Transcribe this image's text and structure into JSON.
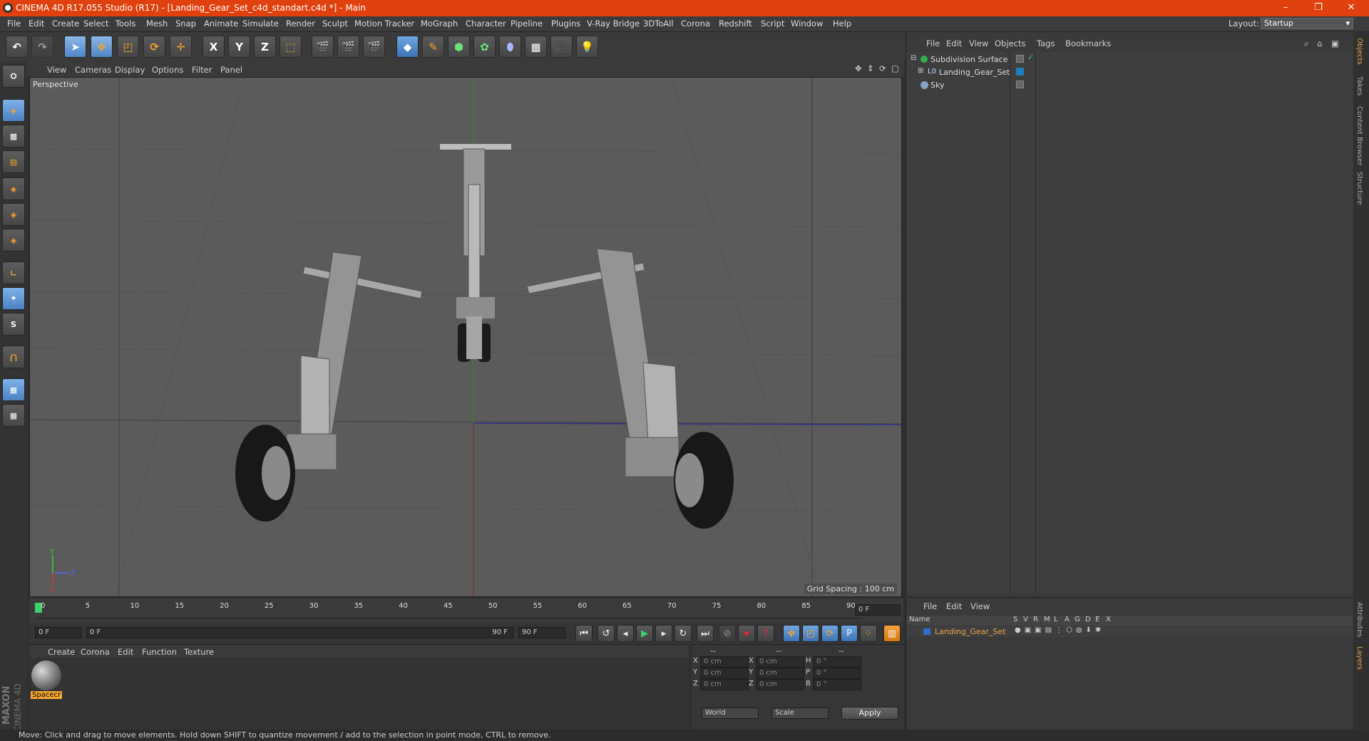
{
  "window": {
    "title": "CINEMA 4D R17.055 Studio (R17) - [Landing_Gear_Set_c4d_standart.c4d *] - Main",
    "controls": [
      "–",
      "❐",
      "✕"
    ]
  },
  "menu": [
    "File",
    "Edit",
    "Create",
    "Select",
    "Tools",
    "Mesh",
    "Snap",
    "Animate",
    "Simulate",
    "Render",
    "Sculpt",
    "Motion Tracker",
    "MoGraph",
    "Character",
    "Pipeline",
    "Plugins",
    "V-Ray Bridge",
    "3DToAll",
    "Corona",
    "Redshift",
    "Script",
    "Window",
    "Help"
  ],
  "layout": {
    "label": "Layout:",
    "value": "Startup"
  },
  "toolbar": {
    "axis_x": "X",
    "axis_y": "Y",
    "axis_z": "Z"
  },
  "left_tools": {
    "snap_s": "S"
  },
  "viewport": {
    "menu": [
      "View",
      "Cameras",
      "Display",
      "Options",
      "Filter",
      "Panel"
    ],
    "label": "Perspective",
    "grid_spacing": "Grid Spacing : 100 cm"
  },
  "timeline": {
    "ticks": [
      "0",
      "5",
      "10",
      "15",
      "20",
      "25",
      "30",
      "35",
      "40",
      "45",
      "50",
      "55",
      "60",
      "65",
      "70",
      "75",
      "80",
      "85",
      "90"
    ],
    "current_frame_field": "0 F",
    "start_field": "0 F",
    "range_start": "0 F",
    "range_end": "90 F",
    "end_field": "90 F"
  },
  "materials": {
    "menu": [
      "Create",
      "Corona",
      "Edit",
      "Function",
      "Texture"
    ],
    "items": [
      {
        "name": "Spacecr"
      }
    ]
  },
  "coordinates": {
    "headers": [
      "--",
      "--",
      "--"
    ],
    "rows": [
      {
        "l1": "X",
        "v1": "0 cm",
        "l2": "X",
        "v2": "0 cm",
        "l3": "H",
        "v3": "0 °"
      },
      {
        "l1": "Y",
        "v1": "0 cm",
        "l2": "Y",
        "v2": "0 cm",
        "l3": "P",
        "v3": "0 °"
      },
      {
        "l1": "Z",
        "v1": "0 cm",
        "l2": "Z",
        "v2": "0 cm",
        "l3": "B",
        "v3": "0 °"
      }
    ],
    "mode": "World",
    "scale": "Scale",
    "apply": "Apply"
  },
  "status": "Move: Click and drag to move elements. Hold down SHIFT to quantize movement / add to the selection in point mode, CTRL to remove.",
  "object_manager": {
    "menu": [
      "File",
      "Edit",
      "View",
      "Objects",
      "Tags",
      "Bookmarks"
    ],
    "objects": [
      {
        "name": "Subdivision Surface",
        "color": "#2fb24c"
      },
      {
        "name": "Landing_Gear_Set",
        "color": "#1f7fc2"
      },
      {
        "name": "Sky",
        "color": "#8aa2c4"
      }
    ]
  },
  "layer_manager": {
    "menu": [
      "File",
      "Edit",
      "View"
    ],
    "columns": [
      "Name",
      "S",
      "V",
      "R",
      "M",
      "L",
      "A",
      "G",
      "D",
      "E",
      "X"
    ],
    "layers": [
      {
        "name": "Landing_Gear_Set",
        "color": "#2d6fd0"
      }
    ]
  },
  "right_tabs": [
    "Objects",
    "Takes",
    "Content Browser",
    "Structure"
  ],
  "right_tabs_bottom": [
    "Attributes",
    "Layers"
  ],
  "branding": {
    "maxon": "MAXON",
    "c4d": "CINEMA 4D"
  },
  "colors": {
    "title_bar": "#e0400e",
    "accent": "#4e86c6",
    "highlight": "#e8a34a"
  }
}
